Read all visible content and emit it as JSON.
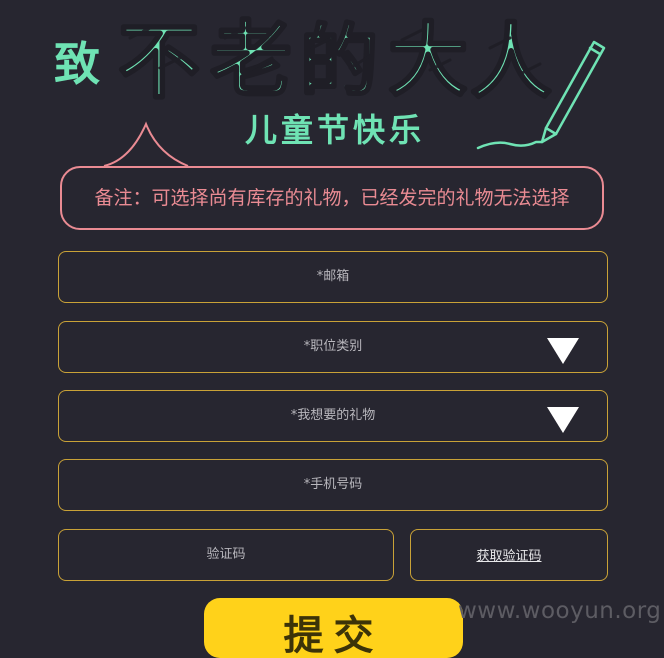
{
  "header": {
    "title": "致不老的大人",
    "subtitle": "儿童节快乐"
  },
  "note": {
    "text": "备注：可选择尚有库存的礼物，已经发完的礼物无法选择"
  },
  "form": {
    "email_placeholder": "*邮箱",
    "job_category_placeholder": "*职位类别",
    "gift_placeholder": "*我想要的礼物",
    "phone_placeholder": "*手机号码",
    "code_placeholder": "验证码",
    "get_code_label": "获取验证码",
    "submit_label": "提交"
  },
  "watermark": "www.wooyun.org",
  "colors": {
    "background": "#272630",
    "accent_green": "#6fe3b4",
    "note_pink": "#ea8b93",
    "field_border": "#c9a237",
    "submit_yellow": "#ffd21a"
  },
  "icons": {
    "dropdown": "triangle-down-icon",
    "decoration": "pencil-icon"
  }
}
